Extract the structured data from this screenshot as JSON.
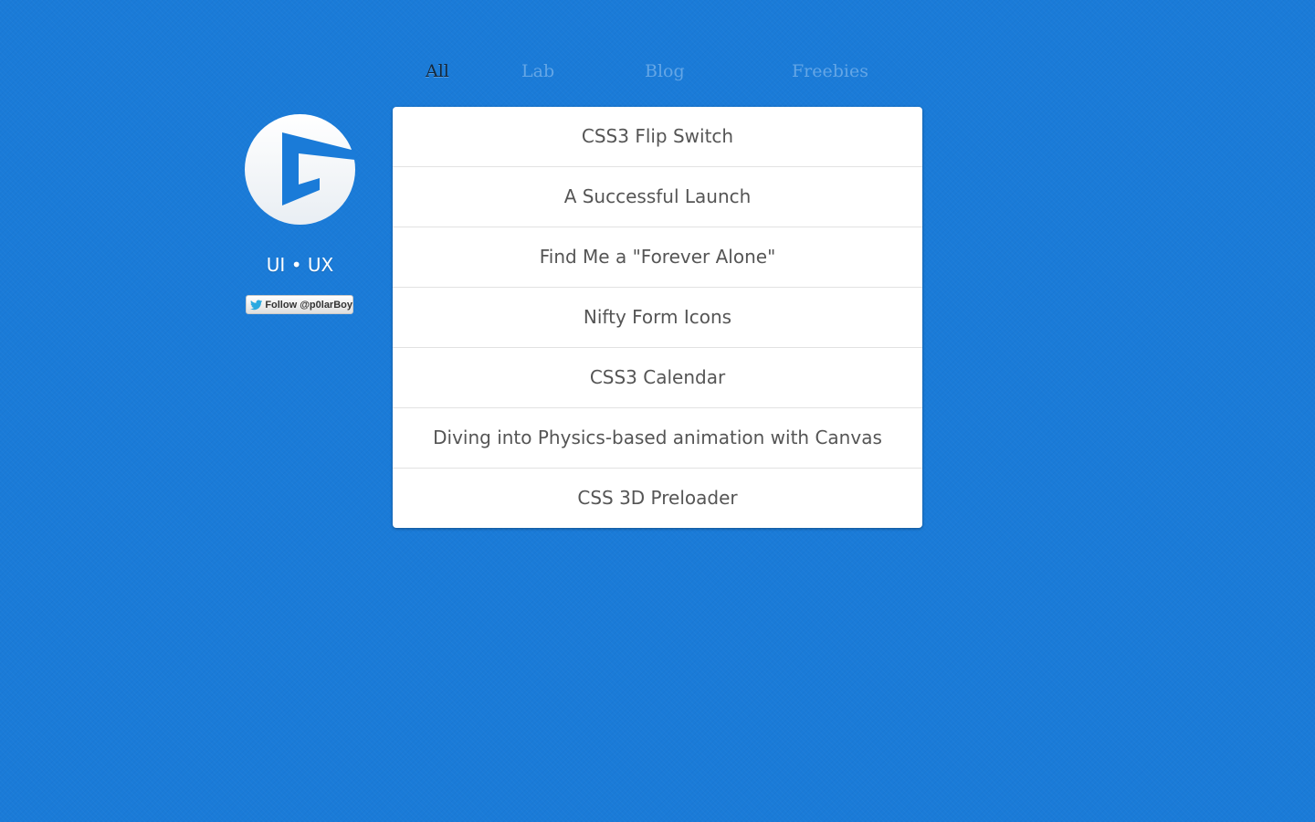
{
  "nav": {
    "tabs": [
      {
        "label": "All",
        "active": true
      },
      {
        "label": "Lab",
        "active": false
      },
      {
        "label": "Blog",
        "active": false
      },
      {
        "label": "Freebies",
        "active": false
      }
    ]
  },
  "sidebar": {
    "logo_icon": "c-logo-icon",
    "tagline": "UI • UX",
    "follow_button": {
      "label": "Follow @p0larBoy",
      "icon": "twitter-bird-icon"
    }
  },
  "posts": [
    {
      "title": "CSS3 Flip Switch"
    },
    {
      "title": "A Successful Launch"
    },
    {
      "title": "Find Me a \"Forever Alone\""
    },
    {
      "title": "Nifty Form Icons"
    },
    {
      "title": "CSS3 Calendar"
    },
    {
      "title": "Diving into Physics-based animation with Canvas"
    },
    {
      "title": "CSS 3D Preloader"
    }
  ],
  "colors": {
    "background": "#1a7bd8",
    "active_tab": "#15283b",
    "inactive_tab": "#64a6e6",
    "card_text": "#555555",
    "twitter_blue": "#2aa9e0"
  }
}
